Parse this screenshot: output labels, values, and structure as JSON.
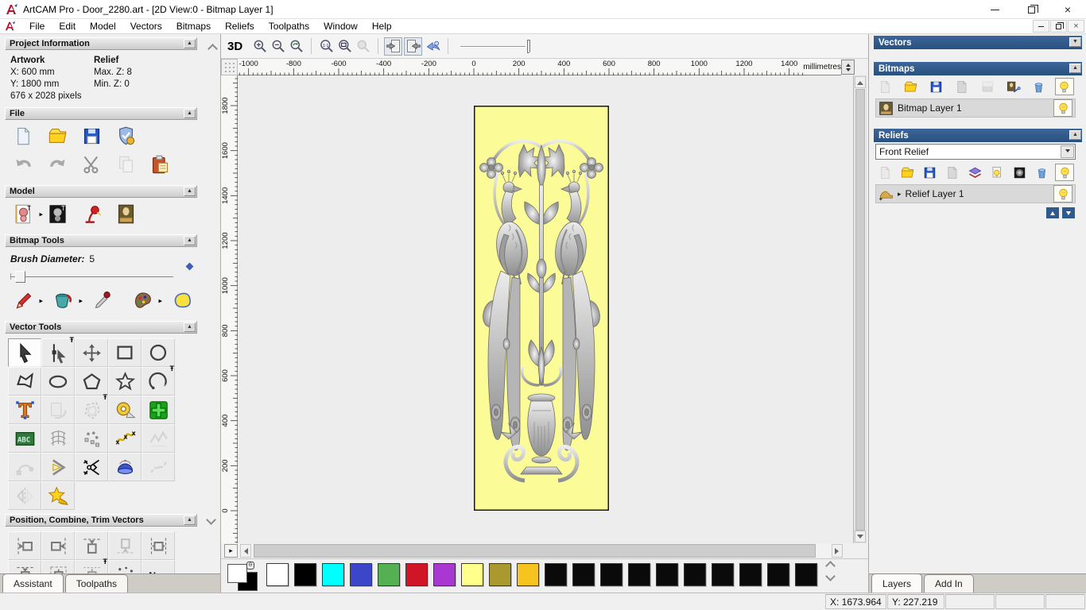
{
  "window": {
    "title": "ArtCAM Pro - Door_2280.art - [2D View:0 - Bitmap Layer 1]"
  },
  "menu": {
    "items": [
      "File",
      "Edit",
      "Model",
      "Vectors",
      "Bitmaps",
      "Reliefs",
      "Toolpaths",
      "Window",
      "Help"
    ]
  },
  "left_panel": {
    "project_information": {
      "title": "Project Information",
      "artwork_heading": "Artwork",
      "relief_heading": "Relief",
      "artwork_x": "X: 600 mm",
      "artwork_y": "Y: 1800 mm",
      "artwork_pixels": "676 x 2028 pixels",
      "relief_max_z": "Max. Z: 8",
      "relief_min_z": "Min. Z: 0"
    },
    "file": {
      "title": "File",
      "row1": [
        {
          "icon": "new-model"
        },
        {
          "icon": "open-model"
        },
        {
          "icon": "save-model"
        },
        {
          "icon": "model-properties"
        }
      ],
      "row2": [
        {
          "icon": "undo"
        },
        {
          "icon": "redo"
        },
        {
          "icon": "cut"
        },
        {
          "icon": "copy",
          "disabled": true
        },
        {
          "icon": "paste"
        }
      ]
    },
    "model": {
      "title": "Model",
      "buttons": [
        {
          "icon": "set-model-size",
          "flyout": true
        },
        {
          "icon": "greyscale-model"
        },
        {
          "icon": "lighting"
        },
        {
          "icon": "texture-relief"
        }
      ]
    },
    "bitmap_tools": {
      "title": "Bitmap Tools",
      "brush_label": "Brush Diameter:",
      "brush_value": "5",
      "buttons": [
        {
          "icon": "paint",
          "flyout": true
        },
        {
          "icon": "flood-fill",
          "flyout": true
        },
        {
          "icon": "pick-colour"
        },
        {
          "icon": "colour-palette",
          "flyout": true
        },
        {
          "icon": "texture-flood"
        }
      ]
    },
    "vector_tools": {
      "title": "Vector Tools",
      "rows": [
        [
          {
            "icon": "select-vectors",
            "active": true
          },
          {
            "icon": "node-editing",
            "pin": true
          },
          {
            "icon": "transform-vectors"
          },
          {
            "icon": "create-rectangle"
          },
          {
            "icon": "create-circle"
          }
        ],
        [
          {
            "icon": "create-polyline"
          },
          {
            "icon": "create-ellipse"
          },
          {
            "icon": "create-polygon"
          },
          {
            "icon": "create-star"
          },
          {
            "icon": "create-arc",
            "pin": true
          }
        ],
        [
          {
            "icon": "create-text"
          },
          {
            "icon": "wrap-text",
            "disabled": true
          },
          {
            "icon": "offset-vectors",
            "disabled": true,
            "pin": true
          },
          {
            "icon": "measure"
          },
          {
            "icon": "snap-grid"
          }
        ],
        [
          {
            "icon": "text-block"
          },
          {
            "icon": "envelope-distort"
          },
          {
            "icon": "paste-along-curve"
          },
          {
            "icon": "fit-curve"
          },
          {
            "icon": "simplify-vectors",
            "disabled": true
          }
        ],
        [
          {
            "icon": "fit-arcs",
            "disabled": true
          },
          {
            "icon": "bisector"
          },
          {
            "icon": "trim-vectors"
          },
          {
            "icon": "spin-profile"
          },
          {
            "icon": "join-vectors",
            "disabled": true
          }
        ],
        [
          {
            "icon": "mirror-vectors",
            "disabled": true
          },
          {
            "icon": "vector-wizard"
          }
        ]
      ]
    },
    "position_tools": {
      "title": "Position, Combine, Trim Vectors",
      "rows": [
        [
          {
            "icon": "align-left"
          },
          {
            "icon": "align-right"
          },
          {
            "icon": "align-top"
          },
          {
            "icon": "align-bottom",
            "disabled": true
          },
          {
            "icon": "centre-horizontal"
          }
        ],
        [
          {
            "icon": "centre-vertical"
          },
          {
            "icon": "centre-in-page"
          },
          {
            "icon": "align-snap",
            "pin": true
          },
          {
            "icon": "scatter-copies"
          },
          {
            "icon": "nesting"
          }
        ]
      ]
    },
    "tabs": [
      {
        "label": "Assistant",
        "active": true
      },
      {
        "label": "Toolpaths",
        "active": false
      }
    ]
  },
  "toolbar_2d": {
    "view_3d": "3D",
    "group1": [
      {
        "icon": "zoom-in"
      },
      {
        "icon": "zoom-out"
      },
      {
        "icon": "zoom-previous"
      }
    ],
    "group2": [
      {
        "icon": "zoom-1-1"
      },
      {
        "icon": "zoom-fit"
      },
      {
        "icon": "zoom-object",
        "disabled": true
      }
    ],
    "group3": [
      {
        "icon": "previous-bitmap-layer",
        "pressed": true
      },
      {
        "icon": "next-bitmap-layer",
        "pressed": true
      },
      {
        "icon": "preview-vectors"
      }
    ]
  },
  "rulers": {
    "horizontal_labels": [
      "-1000",
      "-800",
      "-600",
      "-400",
      "-200",
      "0",
      "200",
      "400",
      "600",
      "800",
      "1000",
      "1200",
      "1400"
    ],
    "vertical_labels": [
      "1800",
      "1600",
      "1400",
      "1200",
      "1000",
      "800",
      "600",
      "400",
      "200",
      "0"
    ],
    "units": "millimetres"
  },
  "artwork": {
    "panel_color": "#fbfb97"
  },
  "palette": {
    "primary": "#ffffff",
    "secondary": "#000000",
    "colors": [
      "#ffffff",
      "#000000",
      "#00ffff",
      "#3b46c9",
      "#55b054",
      "#d01626",
      "#a937d2",
      "#ffff8c",
      "#a9992e",
      "#f6c31f",
      "#0a0a0a",
      "#0a0a0a",
      "#0a0a0a",
      "#0a0a0a",
      "#0a0a0a",
      "#0a0a0a",
      "#0a0a0a",
      "#0a0a0a",
      "#0a0a0a",
      "#0a0a0a"
    ]
  },
  "right_panel": {
    "vectors": {
      "title": "Vectors"
    },
    "bitmaps": {
      "title": "Bitmaps",
      "toolbar": [
        {
          "icon": "new-bitmap",
          "disabled": true
        },
        {
          "icon": "open-bitmap"
        },
        {
          "icon": "save-bitmap"
        },
        {
          "icon": "paste-bitmap",
          "disabled": true
        },
        {
          "icon": "fade-bitmap",
          "disabled": true
        },
        {
          "icon": "bitmap-to-vector"
        },
        {
          "icon": "delete-bitmap"
        },
        {
          "icon": "toggle-visibility",
          "boxed": true
        }
      ],
      "layers": [
        {
          "name": "Bitmap Layer 1"
        }
      ]
    },
    "reliefs": {
      "title": "Reliefs",
      "dropdown_value": "Front Relief",
      "toolbar": [
        {
          "icon": "new-relief",
          "disabled": true
        },
        {
          "icon": "open-relief"
        },
        {
          "icon": "save-relief"
        },
        {
          "icon": "paste-relief",
          "disabled": true
        },
        {
          "icon": "combine-relief"
        },
        {
          "icon": "relief-properties"
        },
        {
          "icon": "greyscale-view"
        },
        {
          "icon": "delete-relief"
        },
        {
          "icon": "toggle-visibility",
          "boxed": true
        }
      ],
      "layers": [
        {
          "name": "Relief Layer 1"
        }
      ]
    },
    "tabs": [
      {
        "label": "Layers",
        "active": true
      },
      {
        "label": "Add In",
        "active": false
      }
    ]
  },
  "status_bar": {
    "x": "X: 1673.964",
    "y": "Y: 227.219"
  }
}
